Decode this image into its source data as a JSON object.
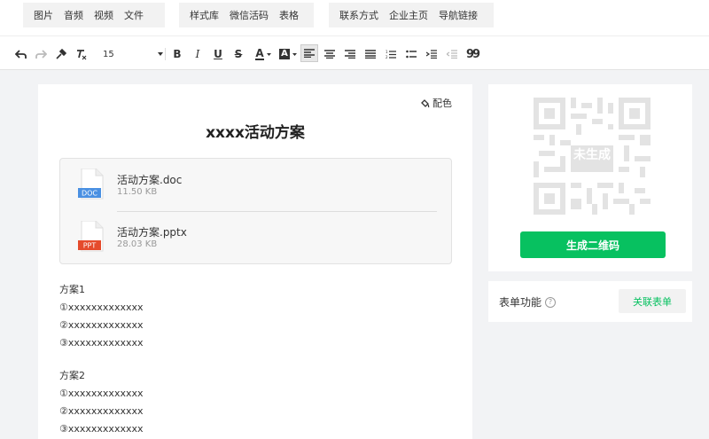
{
  "insert_bar": {
    "group1": [
      "图片",
      "音频",
      "视频",
      "文件"
    ],
    "group2": [
      "样式库",
      "微信活码",
      "表格"
    ],
    "group3": [
      "联系方式",
      "企业主页",
      "导航链接"
    ]
  },
  "format_bar": {
    "font_size": "15",
    "bold": "B",
    "italic": "I",
    "underline": "U",
    "strike": "S",
    "font_color": "A",
    "bg_color": "A",
    "quote": "99"
  },
  "document": {
    "palette_label": "配色",
    "title": "xxxx活动方案",
    "attachments": [
      {
        "name": "活动方案.doc",
        "size": "11.50 KB",
        "badge": "DOC",
        "badge_color": "#4a90e2"
      },
      {
        "name": "活动方案.pptx",
        "size": "28.03 KB",
        "badge": "PPT",
        "badge_color": "#e54b2c"
      }
    ],
    "plans": [
      {
        "heading": "方案1",
        "items": [
          "①xxxxxxxxxxxxx",
          "②xxxxxxxxxxxxx",
          "③xxxxxxxxxxxxx"
        ]
      },
      {
        "heading": "方案2",
        "items": [
          "①xxxxxxxxxxxxx",
          "②xxxxxxxxxxxxx",
          "③xxxxxxxxxxxxx"
        ]
      }
    ]
  },
  "qr_panel": {
    "placeholder_label": "未生成",
    "generate_button": "生成二维码"
  },
  "form_panel": {
    "label": "表单功能",
    "help_icon": "?",
    "link_button": "关联表单"
  },
  "colors": {
    "accent": "#07c160",
    "doc_badge": "#4a90e2",
    "ppt_badge": "#e54b2c"
  }
}
